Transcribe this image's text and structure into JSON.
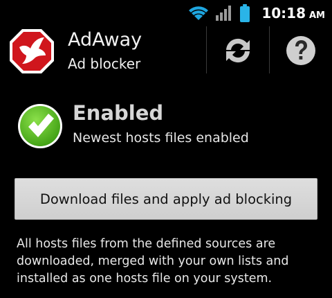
{
  "status_bar": {
    "time": "10:18",
    "ampm": "AM",
    "icons": [
      "wifi-icon",
      "signal-icon",
      "battery-icon"
    ],
    "colors": {
      "wifi": "#1ea6e0",
      "signal": "#9a9a9a",
      "battery": "#2ab4e8"
    }
  },
  "header": {
    "title": "AdAway",
    "subtitle": "Ad blocker",
    "logo_icon": "adaway-logo-icon",
    "actions": [
      {
        "name": "refresh",
        "icon": "refresh-icon"
      },
      {
        "name": "help",
        "icon": "help-icon"
      }
    ]
  },
  "status": {
    "title": "Enabled",
    "description": "Newest hosts files enabled",
    "icon": "checkmark-icon",
    "color": "#4caf1a"
  },
  "download_button": {
    "label": "Download files and apply ad blocking"
  },
  "description": {
    "line1": "All hosts files from the defined sources are",
    "line2": "downloaded, merged with your own lists and",
    "line3": "installed as one hosts file on your system."
  },
  "colors": {
    "background": "#000000",
    "logo_red": "#d0161d",
    "button_bg": "#d8d8d8"
  }
}
